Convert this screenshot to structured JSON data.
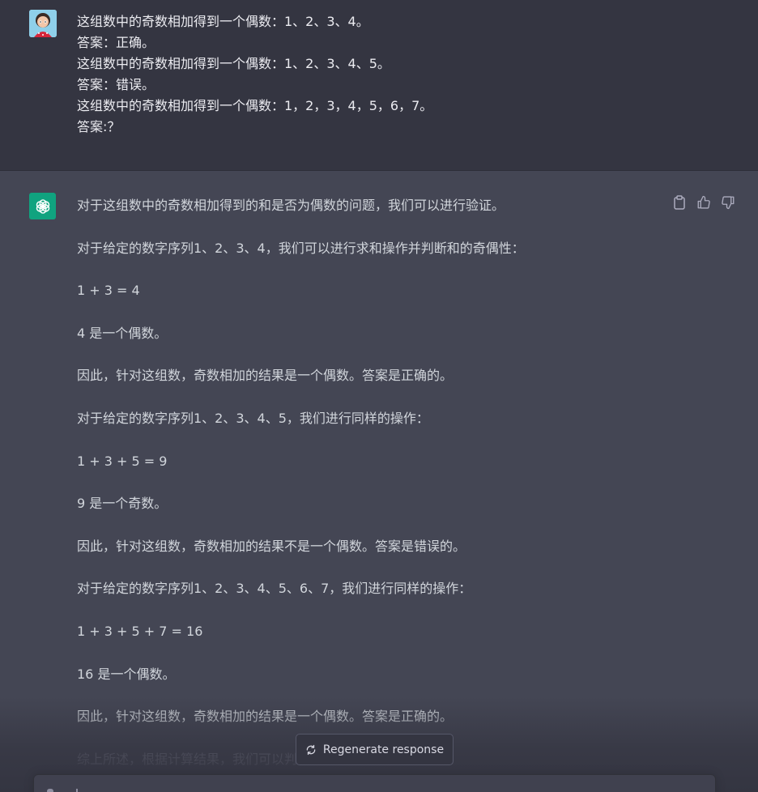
{
  "user_message": {
    "lines": [
      "这组数中的奇数相加得到一个偶数：1、2、3、4。",
      "答案：正确。",
      "这组数中的奇数相加得到一个偶数：1、2、3、4、5。",
      "答案：错误。",
      "这组数中的奇数相加得到一个偶数：1，2，3，4，5，6，7。",
      "答案:？"
    ]
  },
  "assistant_message": {
    "paragraphs": [
      "对于这组数中的奇数相加得到的和是否为偶数的问题，我们可以进行验证。",
      "对于给定的数字序列1、2、3、4，我们可以进行求和操作并判断和的奇偶性：",
      "1 + 3 = 4",
      "4 是一个偶数。",
      "因此，针对这组数，奇数相加的结果是一个偶数。答案是正确的。",
      "对于给定的数字序列1、2、3、4、5，我们进行同样的操作：",
      "1 + 3 + 5 = 9",
      "9 是一个奇数。",
      "因此，针对这组数，奇数相加的结果不是一个偶数。答案是错误的。",
      "对于给定的数字序列1、2、3、4、5、6、7，我们进行同样的操作：",
      "1 + 3 + 5 + 7 = 16",
      "16 是一个偶数。",
      "因此，针对这组数，奇数相加的结果是一个偶数。答案是正确的。",
      "综上所述，根据计算结果，我们可以判断出答案的正确性。"
    ]
  },
  "actions": {
    "copy_icon": "clipboard-icon",
    "like_icon": "thumbs-up-icon",
    "dislike_icon": "thumbs-down-icon"
  },
  "regenerate": {
    "label": "Regenerate response",
    "icon": "refresh-icon"
  },
  "colors": {
    "user_bg": "#343541",
    "assistant_bg": "#444654",
    "openai_green": "#10a37f"
  }
}
